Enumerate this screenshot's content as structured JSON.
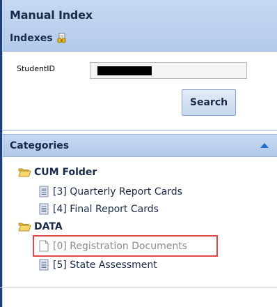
{
  "manual_index": {
    "title": "Manual Index",
    "subtitle": "Indexes",
    "icon": "find-binoculars-icon"
  },
  "search": {
    "student_label": "StudentID",
    "student_value": "",
    "button_label": "Search"
  },
  "categories": {
    "title": "Categories",
    "collapse_icon": "triangle-up-icon",
    "folders": [
      {
        "label": "CUM Folder",
        "icon": "folder-open-icon",
        "items": [
          {
            "label": "[3] Quarterly Report Cards",
            "icon": "document-icon"
          },
          {
            "label": "[4] Final Report Cards",
            "icon": "document-icon"
          }
        ]
      },
      {
        "label": "DATA",
        "icon": "folder-open-icon",
        "items": [
          {
            "label": "[0] Registration Documents",
            "icon": "document-empty-icon",
            "muted": true,
            "highlighted": true
          },
          {
            "label": "[5] State Assessment",
            "icon": "document-icon"
          }
        ]
      }
    ]
  },
  "colors": {
    "header_bg": "#b3cbeb",
    "header_text": "#1a2a4a",
    "highlight_border": "#e04848",
    "arrow": "#1e6fd0"
  }
}
